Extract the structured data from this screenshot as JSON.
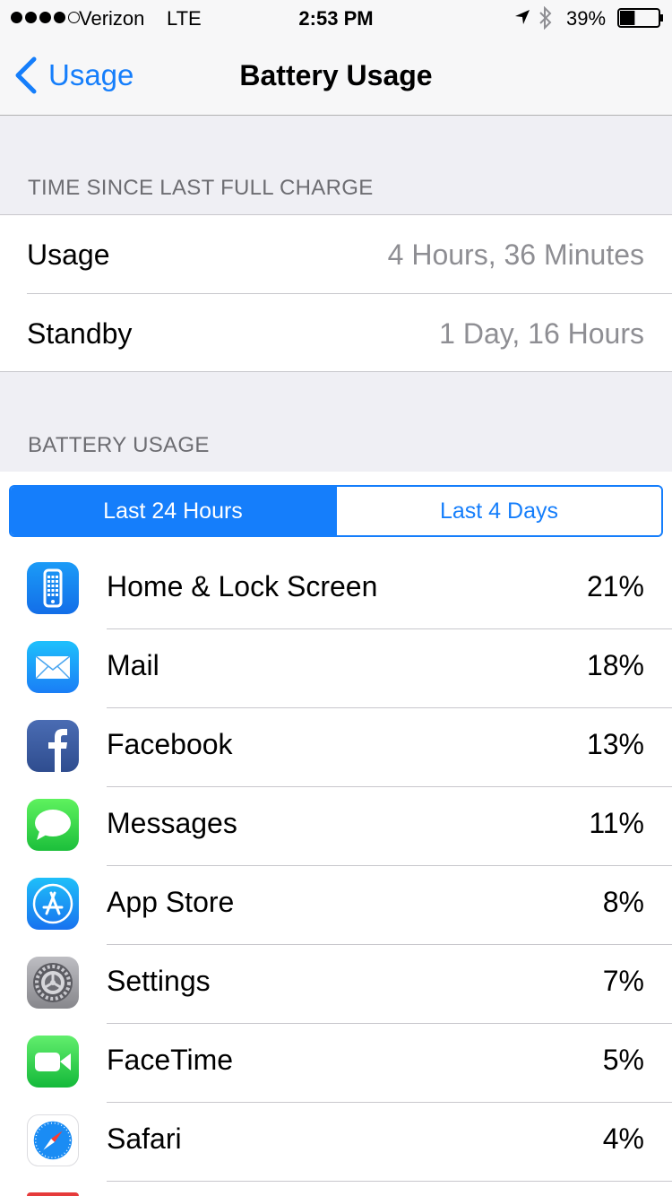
{
  "status_bar": {
    "carrier": "Verizon",
    "network": "LTE",
    "time": "2:53 PM",
    "battery_percent": "39%",
    "battery_level": 0.39,
    "signal_bars_filled": 4,
    "signal_bars_total": 5
  },
  "nav": {
    "back_label": "Usage",
    "title": "Battery Usage"
  },
  "charge_section": {
    "header": "TIME SINCE LAST FULL CHARGE",
    "rows": [
      {
        "label": "Usage",
        "value": "4 Hours, 36 Minutes"
      },
      {
        "label": "Standby",
        "value": "1 Day, 16 Hours"
      }
    ]
  },
  "usage_section": {
    "header": "BATTERY USAGE",
    "segments": [
      {
        "label": "Last 24 Hours",
        "selected": true
      },
      {
        "label": "Last 4 Days",
        "selected": false
      }
    ],
    "apps": [
      {
        "name": "Home & Lock Screen",
        "percent": "21%",
        "icon": "phone-screen-icon",
        "color": "#1a8cf4"
      },
      {
        "name": "Mail",
        "percent": "18%",
        "icon": "mail-icon",
        "color": "#2aa4f4"
      },
      {
        "name": "Facebook",
        "percent": "13%",
        "icon": "facebook-icon",
        "color": "#3b5998"
      },
      {
        "name": "Messages",
        "percent": "11%",
        "icon": "messages-icon",
        "color": "#32c748"
      },
      {
        "name": "App Store",
        "percent": "8%",
        "icon": "app-store-icon",
        "color": "#1e8ef5"
      },
      {
        "name": "Settings",
        "percent": "7%",
        "icon": "settings-gear-icon",
        "color": "#8e8e93"
      },
      {
        "name": "FaceTime",
        "percent": "5%",
        "icon": "facetime-camera-icon",
        "color": "#2fc34a"
      },
      {
        "name": "Safari",
        "percent": "4%",
        "icon": "safari-compass-icon",
        "color": "#1a8cf4"
      }
    ]
  },
  "colors": {
    "accent": "#157efb",
    "background": "#efeff4",
    "secondary_text": "#8e8e93"
  }
}
